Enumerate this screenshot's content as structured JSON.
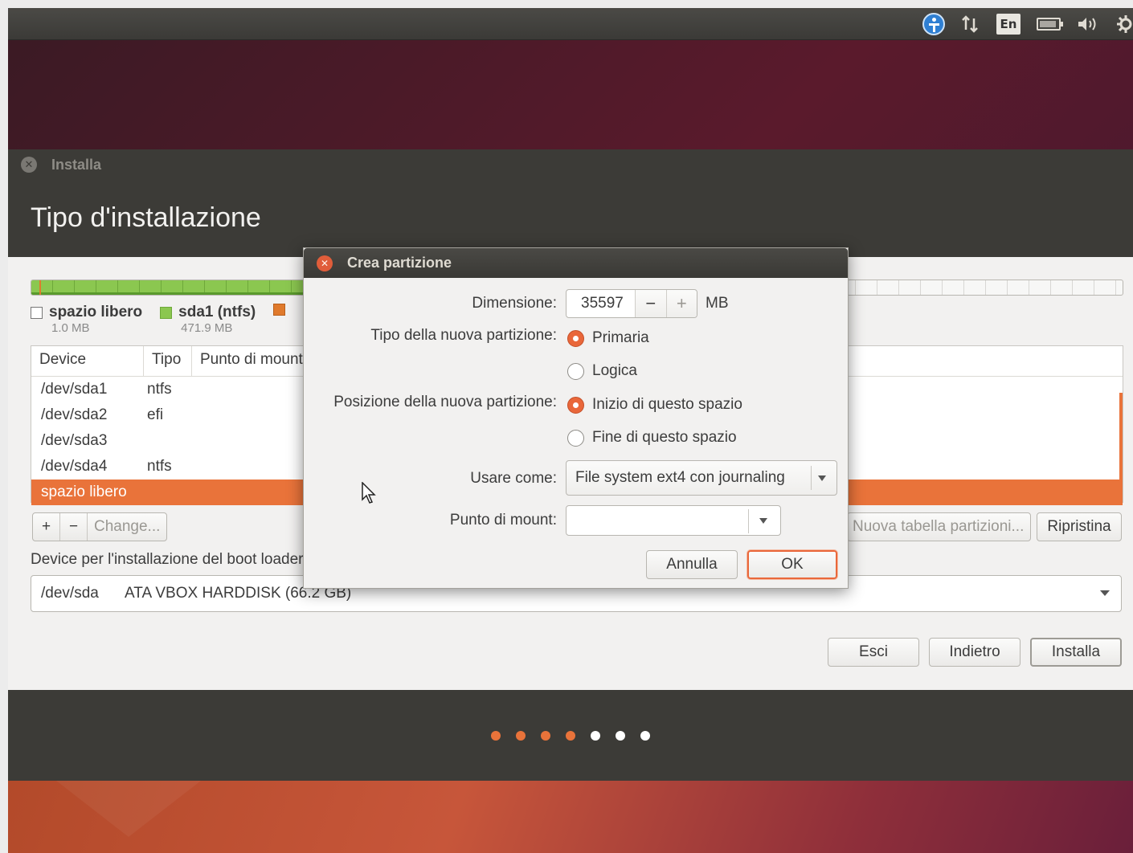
{
  "panel": {
    "language": "En"
  },
  "window": {
    "title": "Installa",
    "page_title": "Tipo d'installazione"
  },
  "legend": [
    {
      "label": "spazio libero",
      "size": "1.0 MB",
      "color": "#ffffff"
    },
    {
      "label": "sda1 (ntfs)",
      "size": "471.9 MB",
      "color": "#8bc750"
    },
    {
      "label": "",
      "size": "",
      "color": "#e07a2c"
    }
  ],
  "table": {
    "headers": [
      "Device",
      "Tipo",
      "Punto di mount"
    ],
    "rows": [
      {
        "device": "/dev/sda1",
        "type": "ntfs"
      },
      {
        "device": "/dev/sda2",
        "type": "efi"
      },
      {
        "device": "/dev/sda3",
        "type": ""
      },
      {
        "device": "/dev/sda4",
        "type": "ntfs"
      },
      {
        "device": "spazio libero",
        "type": ""
      }
    ]
  },
  "toolbar": {
    "add": "+",
    "remove": "−",
    "change": "Change...",
    "new_table": "Nuova tabella partizioni...",
    "reset": "Ripristina"
  },
  "boot": {
    "label": "Device per l'installazione del boot loader:",
    "device": "/dev/sda",
    "description": "ATA VBOX HARDDISK (66.2 GB)"
  },
  "actions": {
    "quit": "Esci",
    "back": "Indietro",
    "install": "Installa"
  },
  "progress": {
    "total_steps": 7,
    "completed_steps": 4
  },
  "colors": {
    "accent": "#e9733a",
    "dot_done": "#e9733a",
    "dot_todo": "#ffffff"
  },
  "dialog": {
    "title": "Crea partizione",
    "size_label": "Dimensione:",
    "size_value": "35597",
    "size_unit": "MB",
    "minus": "−",
    "plus": "+",
    "type_label": "Tipo della nuova partizione:",
    "type_primary": "Primaria",
    "type_logical": "Logica",
    "position_label": "Posizione della nuova partizione:",
    "position_start": "Inizio di questo spazio",
    "position_end": "Fine di questo spazio",
    "use_as_label": "Usare come:",
    "use_as_value": "File system ext4 con journaling",
    "mount_label": "Punto di mount:",
    "mount_value": "",
    "cancel": "Annulla",
    "ok": "OK"
  }
}
